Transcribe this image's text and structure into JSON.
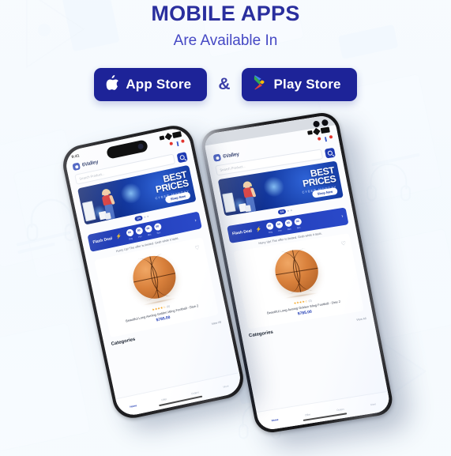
{
  "header": {
    "title": "MOBILE APPS",
    "subtitle": "Are Available In"
  },
  "stores": {
    "separator": "&",
    "app_store": {
      "label": "App Store",
      "icon": "apple-icon",
      "bg_color": "#1d2398"
    },
    "play_store": {
      "label": "Play Store",
      "icon": "google-play-icon",
      "bg_color": "#1d2398"
    }
  },
  "colors": {
    "heading": "#2a2f9e",
    "subheading": "#4548c4",
    "brand_blue": "#1f3bb3",
    "page_bg": "#f7fafd",
    "banner_blue": "#12379e",
    "price_blue": "#1f3bb3"
  },
  "app": {
    "status_bar": {
      "time": "9:41",
      "signal": "signal-bars-icon",
      "wifi": "wifi-icon",
      "battery": "battery-icon"
    },
    "brand": {
      "name": "6Valley",
      "logo": "6valley-logo-icon"
    },
    "header_icons": [
      {
        "name": "notification-bell-icon",
        "badge": ""
      },
      {
        "name": "shopping-cart-icon",
        "badge": ""
      }
    ],
    "search": {
      "placeholder": "Search Product...",
      "button_icon": "search-icon"
    },
    "banner": {
      "title_line1": "BEST",
      "title_line2": "PRICES",
      "subtitle": "CYBER MONDAY",
      "cta": "Shop Now",
      "pager": {
        "current": "1/3",
        "dots": 2
      }
    },
    "flash_deal": {
      "label": "Flash Deal",
      "bolt_icon": "lightning-bolt-icon",
      "timers": [
        {
          "value": "00",
          "label": "Day"
        },
        {
          "value": "00",
          "label": "Hrs"
        },
        {
          "value": "00",
          "label": "Min"
        },
        {
          "value": "00",
          "label": "Sec"
        }
      ],
      "arrow_icon": "chevron-right-icon",
      "note": "Hurry Up! The offer is limited. Grab while it lasts."
    },
    "product": {
      "image": "basketball-icon",
      "wishlist_icon": "heart-icon",
      "stars": "★★★★☆",
      "review_count": "(0)",
      "title": "Beautiful Long Awning Golden Wing Football - Dise 2",
      "price": "$785.00"
    },
    "categories": {
      "title": "Categories",
      "view_all": "View All"
    },
    "bottom_nav": [
      {
        "label": "Home",
        "icon": "home-icon",
        "active": true
      },
      {
        "label": "Offer",
        "icon": "offer-tag-icon",
        "active": false
      },
      {
        "label": "Orders",
        "icon": "orders-list-icon",
        "active": false
      },
      {
        "label": "More",
        "icon": "grid-more-icon",
        "active": false
      }
    ]
  }
}
